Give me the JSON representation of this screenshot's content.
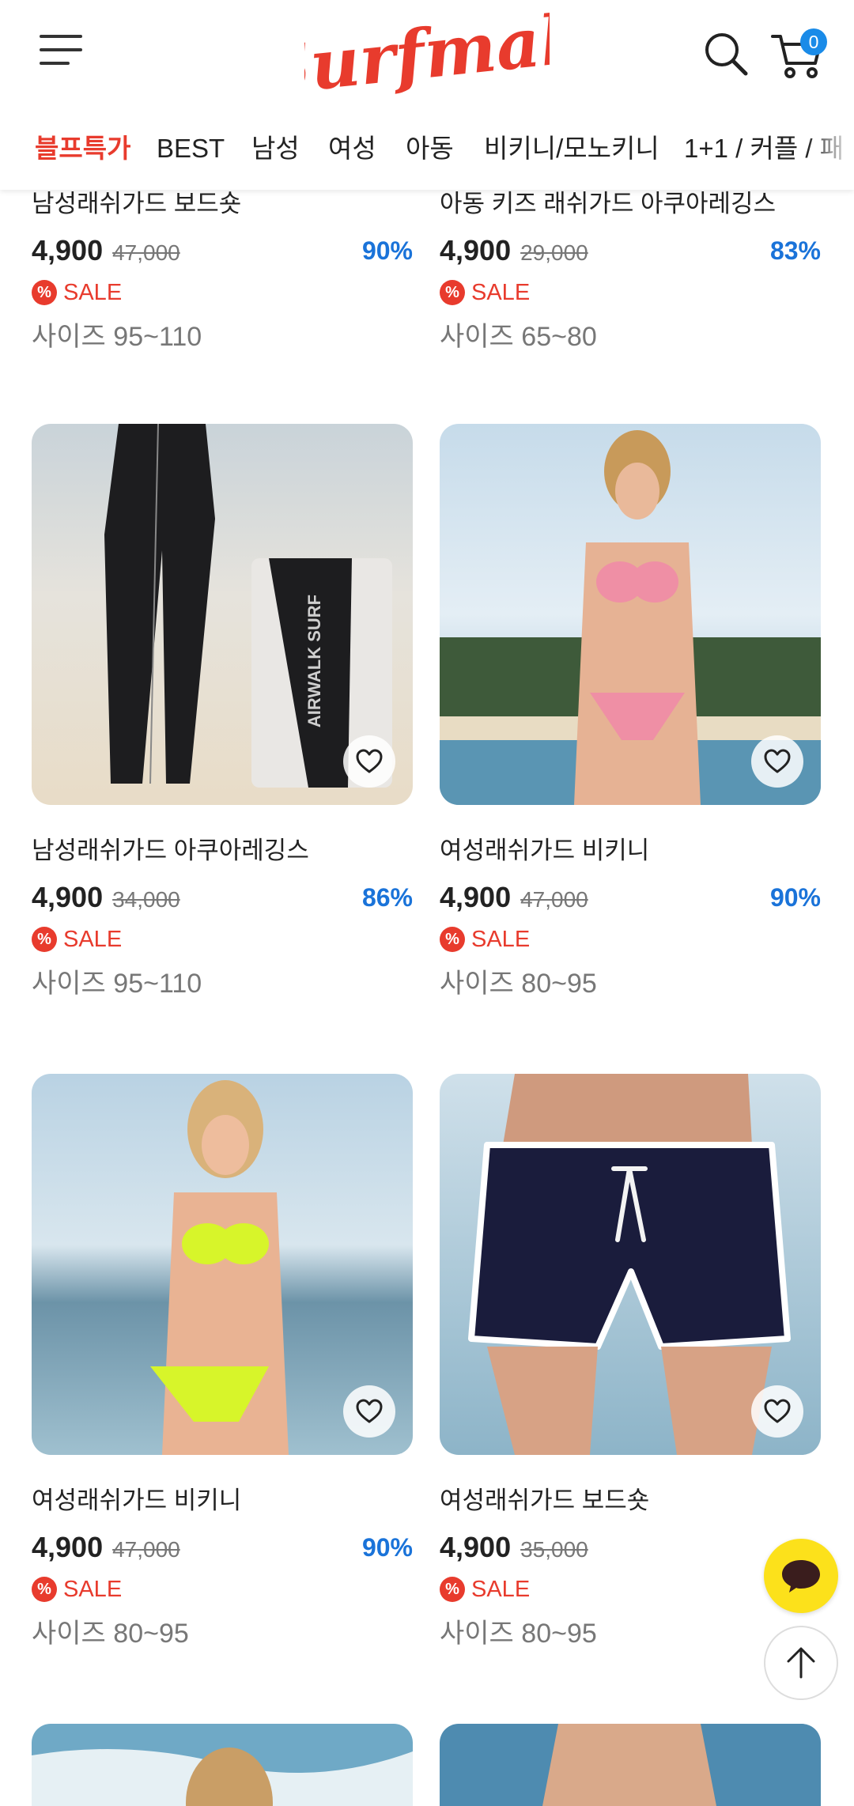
{
  "header": {
    "logo_text": "Surfmall",
    "cart_count": "0",
    "categories": [
      "블프특가",
      "BEST",
      "남성",
      "여성",
      "아동",
      "비키니/모노키니",
      "1+1 / 커플 / 패"
    ]
  },
  "products": [
    {
      "name": "남성래쉬가드 보드숏",
      "price": "4,900",
      "original_price": "47,000",
      "discount": "90%",
      "badge": "SALE",
      "size": "사이즈 95~110"
    },
    {
      "name": "아동 키즈 래쉬가드 아쿠아레깅스",
      "price": "4,900",
      "original_price": "29,000",
      "discount": "83%",
      "badge": "SALE",
      "size": "사이즈 65~80"
    },
    {
      "name": "남성래쉬가드 아쿠아레깅스",
      "price": "4,900",
      "original_price": "34,000",
      "discount": "86%",
      "badge": "SALE",
      "size": "사이즈 95~110",
      "image_text": "AIRWALK SURF"
    },
    {
      "name": "여성래쉬가드 비키니",
      "price": "4,900",
      "original_price": "47,000",
      "discount": "90%",
      "badge": "SALE",
      "size": "사이즈 80~95"
    },
    {
      "name": "여성래쉬가드 비키니",
      "price": "4,900",
      "original_price": "47,000",
      "discount": "90%",
      "badge": "SALE",
      "size": "사이즈 80~95"
    },
    {
      "name": "여성래쉬가드 보드숏",
      "price": "4,900",
      "original_price": "35,000",
      "discount": "",
      "badge": "SALE",
      "size": "사이즈 80~95"
    }
  ],
  "colors": {
    "brand_red": "#e83b2d",
    "discount_blue": "#1a73d9",
    "badge_blue": "#1a8be8",
    "chat_yellow": "#fce11b"
  },
  "icons": [
    "hamburger-menu-icon",
    "search-icon",
    "cart-icon",
    "heart-icon",
    "sale-percent-icon",
    "chat-bubble-icon",
    "arrow-up-icon"
  ]
}
